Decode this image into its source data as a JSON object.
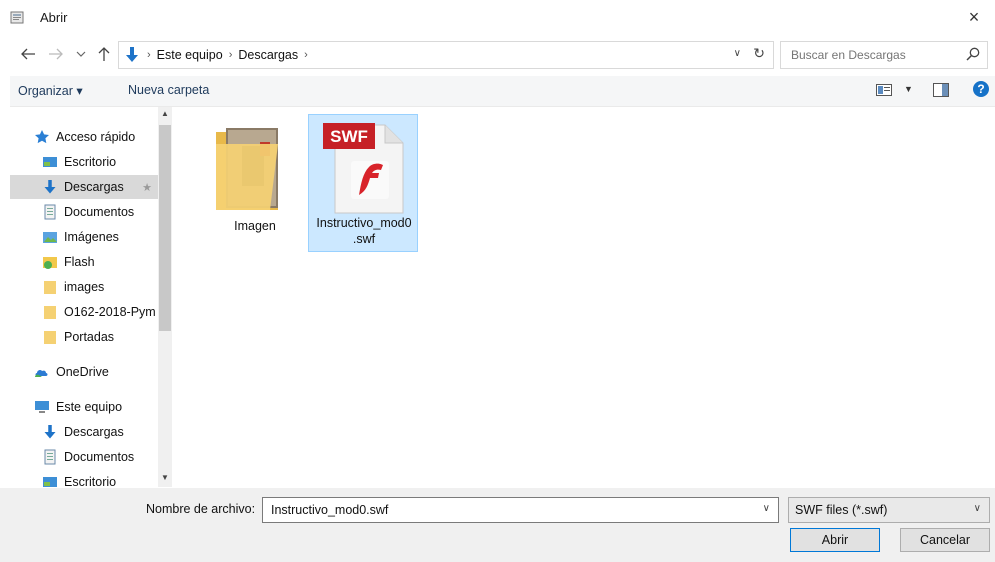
{
  "window": {
    "title": "Abrir",
    "close_glyph": "×"
  },
  "address": {
    "breadcrumb": [
      "Este equipo",
      "Descargas"
    ],
    "separator": "›"
  },
  "search": {
    "placeholder": "Buscar en Descargas"
  },
  "toolbar": {
    "organize_label": "Organizar ▾",
    "new_folder_label": "Nueva carpeta",
    "help_glyph": "?"
  },
  "sidebar": {
    "items": [
      {
        "label": "Acceso rápido",
        "icon": "star-icon",
        "pinned": false
      },
      {
        "label": "Escritorio",
        "icon": "desktop-icon",
        "pinned": true
      },
      {
        "label": "Descargas",
        "icon": "download-icon",
        "pinned": true,
        "selected": true
      },
      {
        "label": "Documentos",
        "icon": "documents-icon",
        "pinned": true
      },
      {
        "label": "Imágenes",
        "icon": "pictures-icon",
        "pinned": true
      },
      {
        "label": "Flash",
        "icon": "flash-folder-icon",
        "pinned": false
      },
      {
        "label": "images",
        "icon": "folder-icon",
        "pinned": false
      },
      {
        "label": "O162-2018-Pym",
        "icon": "folder-icon",
        "pinned": false
      },
      {
        "label": "Portadas",
        "icon": "folder-icon",
        "pinned": false
      },
      {
        "label": "OneDrive",
        "icon": "onedrive-icon",
        "pinned": false
      },
      {
        "label": "Este equipo",
        "icon": "pc-icon",
        "pinned": false
      },
      {
        "label": "Descargas",
        "icon": "download-icon",
        "pinned": false
      },
      {
        "label": "Documentos",
        "icon": "documents-icon",
        "pinned": false
      },
      {
        "label": "Escritorio",
        "icon": "desktop-icon",
        "pinned": false
      }
    ]
  },
  "files": [
    {
      "name": "Imagen",
      "type": "folder",
      "selected": false
    },
    {
      "name": "Instructivo_mod0.swf",
      "display_name_line1": "Instructivo_mod0",
      "display_name_line2": ".swf",
      "type": "swf",
      "badge": "SWF",
      "selected": true
    }
  ],
  "footer": {
    "filename_label": "Nombre de archivo:",
    "filename_value": "Instructivo_mod0.swf",
    "filetype_value": "SWF files (*.swf)",
    "open_label": "Abrir",
    "cancel_label": "Cancelar"
  },
  "colors": {
    "accent": "#0078d7",
    "selection": "#cce8ff",
    "swf_red": "#c62026"
  }
}
